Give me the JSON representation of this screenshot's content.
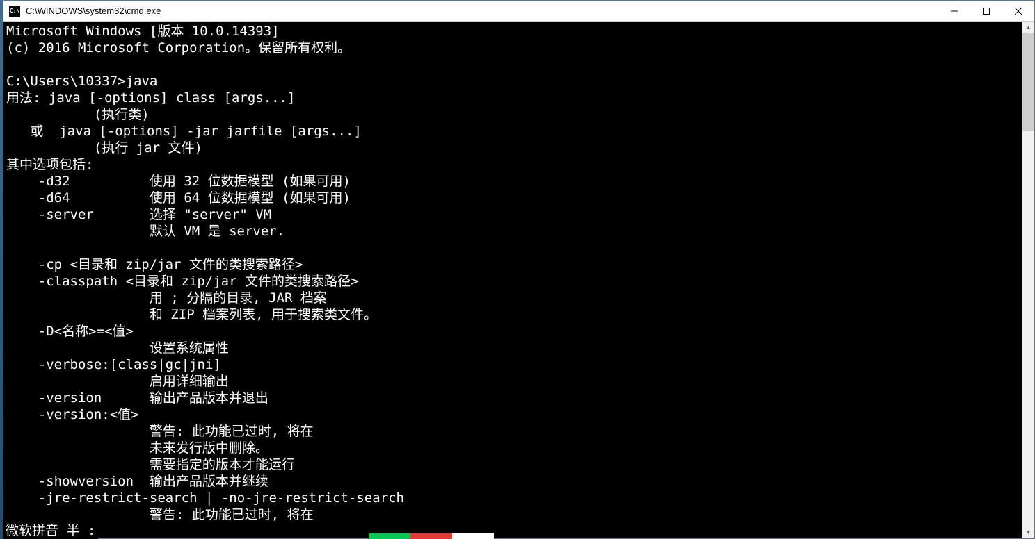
{
  "window": {
    "title": "C:\\WINDOWS\\system32\\cmd.exe",
    "icon_text": "C:\\"
  },
  "terminal": {
    "lines": [
      "Microsoft Windows [版本 10.0.14393]",
      "(c) 2016 Microsoft Corporation。保留所有权利。",
      "",
      "C:\\Users\\10337>java",
      "用法: java [-options] class [args...]",
      "           (执行类)",
      "   或  java [-options] -jar jarfile [args...]",
      "           (执行 jar 文件)",
      "其中选项包括:",
      "    -d32          使用 32 位数据模型 (如果可用)",
      "    -d64          使用 64 位数据模型 (如果可用)",
      "    -server       选择 \"server\" VM",
      "                  默认 VM 是 server.",
      "",
      "    -cp <目录和 zip/jar 文件的类搜索路径>",
      "    -classpath <目录和 zip/jar 文件的类搜索路径>",
      "                  用 ; 分隔的目录, JAR 档案",
      "                  和 ZIP 档案列表, 用于搜索类文件。",
      "    -D<名称>=<值>",
      "                  设置系统属性",
      "    -verbose:[class|gc|jni]",
      "                  启用详细输出",
      "    -version      输出产品版本并退出",
      "    -version:<值>",
      "                  警告: 此功能已过时, 将在",
      "                  未来发行版中删除。",
      "                  需要指定的版本才能运行",
      "    -showversion  输出产品版本并继续",
      "    -jre-restrict-search | -no-jre-restrict-search",
      "                  警告: 此功能已过时, 将在"
    ]
  },
  "ime": {
    "status": "微软拼音 半 :"
  }
}
